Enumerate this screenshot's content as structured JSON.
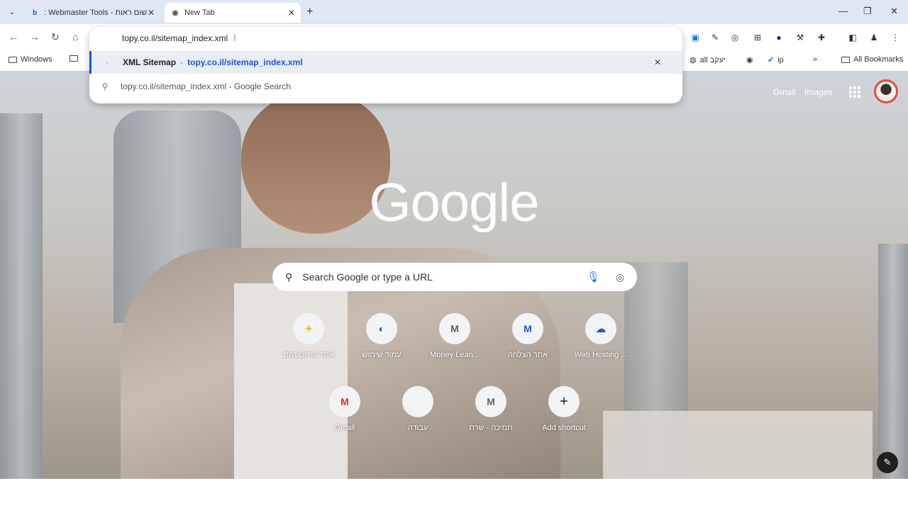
{
  "tabs": [
    {
      "title": ": Webmaster Tools - שום ראות",
      "favicon": "b",
      "close": "✕"
    },
    {
      "title": "New Tab",
      "favicon": "◉",
      "close": "✕"
    }
  ],
  "new_tab_symbol": "+",
  "window_controls": {
    "minimize": "—",
    "maximize": "❐",
    "close": "✕"
  },
  "tab_search_symbol": "⌄",
  "nav": {
    "back": "←",
    "forward": "→",
    "reload": "↻",
    "home": "⌂"
  },
  "omnibox": {
    "input_value": "topy.co.il/sitemap_index.xml",
    "caret": "I",
    "suggestion": {
      "title": "XML Sitemap",
      "separator": "-",
      "url": "topy.co.il/sitemap_index.xml",
      "remove": "✕"
    },
    "search_suggestion": {
      "text": "topy.co.il/sitemap_index.xml - Google Search"
    }
  },
  "bookmarks": {
    "left": [
      {
        "label": "Windows"
      },
      {
        "label": "..."
      }
    ],
    "right": [
      {
        "label": "all יעקב"
      },
      {
        "label": ""
      },
      {
        "label": "ip"
      }
    ],
    "overflow": "»",
    "all_bookmarks": "All Bookmarks"
  },
  "ntp": {
    "gmail": "Gmail",
    "images": "Images",
    "logo": "Google",
    "search_placeholder": "Search Google or type a URL",
    "shortcuts_row1": [
      {
        "label": "אתר קידום נהמ",
        "icon": "✦",
        "color": "#e8c22f"
      },
      {
        "label": "עמוד שימוש",
        "icon": "◐",
        "color": "#1a57d6"
      },
      {
        "label": "Money Lean...",
        "icon": "M",
        "color": "#5f6368"
      },
      {
        "label": "אתר הצלחה",
        "icon": "M",
        "color": "#1a57d6"
      },
      {
        "label": "Web Hosting ...",
        "icon": "☁",
        "color": "#2a52be"
      }
    ],
    "shortcuts_row2": [
      {
        "label": "Gmail",
        "icon": "M",
        "color": "#d93025"
      },
      {
        "label": "עבודה",
        "icon": "",
        "color": "#5f6368"
      },
      {
        "label": "תמיכה - שרת",
        "icon": "M",
        "color": "#5f6368"
      },
      {
        "label": "Add shortcut",
        "icon": "+",
        "color": "#202124"
      }
    ],
    "edit_icon": "✎"
  }
}
